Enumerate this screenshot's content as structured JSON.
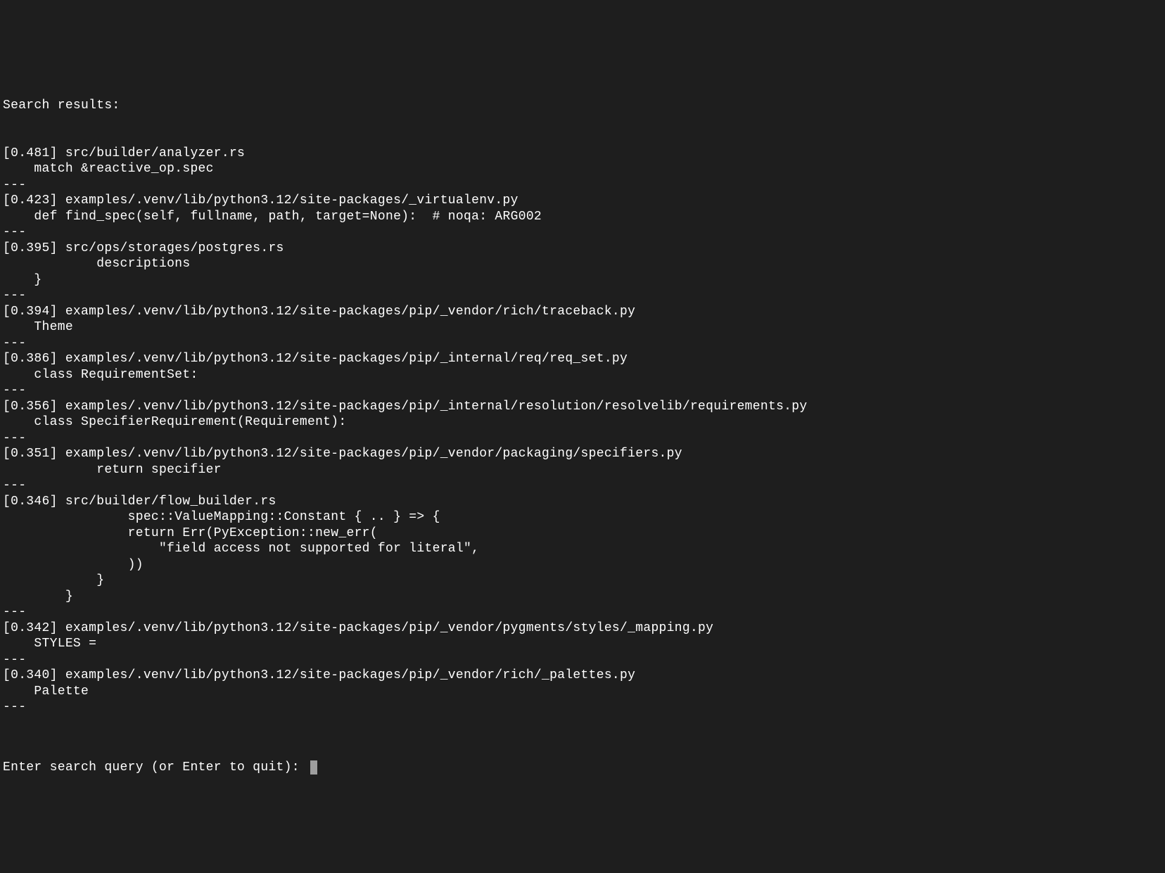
{
  "header": "Search results:",
  "results": [
    {
      "score": "0.481",
      "path": "src/builder/analyzer.rs",
      "snippet": "    match &reactive_op.spec"
    },
    {
      "score": "0.423",
      "path": "examples/.venv/lib/python3.12/site-packages/_virtualenv.py",
      "snippet": "    def find_spec(self, fullname, path, target=None):  # noqa: ARG002"
    },
    {
      "score": "0.395",
      "path": "src/ops/storages/postgres.rs",
      "snippet": "            descriptions\n    }"
    },
    {
      "score": "0.394",
      "path": "examples/.venv/lib/python3.12/site-packages/pip/_vendor/rich/traceback.py",
      "snippet": "    Theme"
    },
    {
      "score": "0.386",
      "path": "examples/.venv/lib/python3.12/site-packages/pip/_internal/req/req_set.py",
      "snippet": "    class RequirementSet:"
    },
    {
      "score": "0.356",
      "path": "examples/.venv/lib/python3.12/site-packages/pip/_internal/resolution/resolvelib/requirements.py",
      "snippet": "    class SpecifierRequirement(Requirement):"
    },
    {
      "score": "0.351",
      "path": "examples/.venv/lib/python3.12/site-packages/pip/_vendor/packaging/specifiers.py",
      "snippet": "            return specifier"
    },
    {
      "score": "0.346",
      "path": "src/builder/flow_builder.rs",
      "snippet": "                spec::ValueMapping::Constant { .. } => {\n                return Err(PyException::new_err(\n                    \"field access not supported for literal\",\n                ))\n            }\n        }"
    },
    {
      "score": "0.342",
      "path": "examples/.venv/lib/python3.12/site-packages/pip/_vendor/pygments/styles/_mapping.py",
      "snippet": "    STYLES ="
    },
    {
      "score": "0.340",
      "path": "examples/.venv/lib/python3.12/site-packages/pip/_vendor/rich/_palettes.py",
      "snippet": "    Palette"
    }
  ],
  "separator": "---",
  "prompt": "Enter search query (or Enter to quit): "
}
